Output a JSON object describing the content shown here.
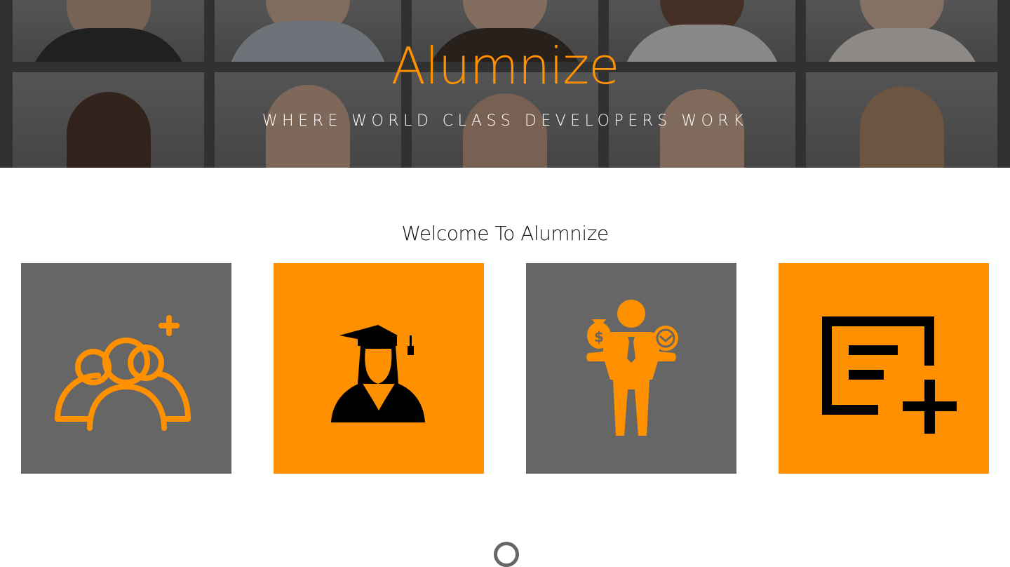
{
  "hero": {
    "brand": "Alumnize",
    "tagline": "WHERE WORLD CLASS DEVELOPERS WORK"
  },
  "main": {
    "welcome_heading": "Welcome To Alumnize",
    "tiles": [
      {
        "icon": "add-group-icon",
        "bg": "#666666",
        "fg": "#ff9100"
      },
      {
        "icon": "graduate-icon",
        "bg": "#ff9100",
        "fg": "#000000"
      },
      {
        "icon": "businessman-money-time-icon",
        "bg": "#666666",
        "fg": "#ff9100"
      },
      {
        "icon": "add-post-icon",
        "bg": "#ff9100",
        "fg": "#000000"
      }
    ]
  },
  "colors": {
    "accent": "#ff9100",
    "tile_gray": "#666666"
  }
}
